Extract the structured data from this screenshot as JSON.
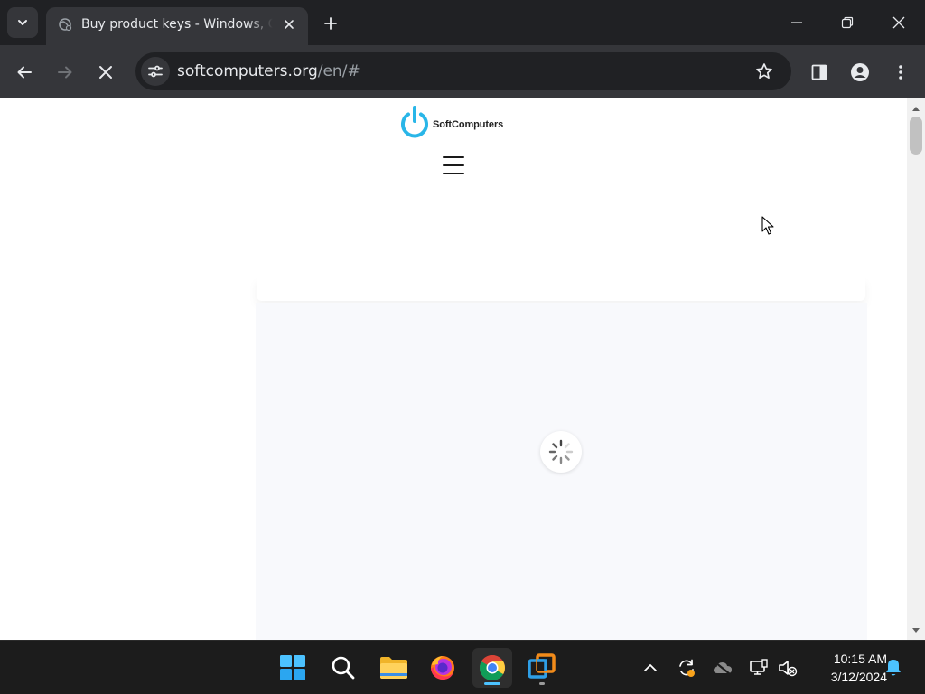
{
  "browser": {
    "tab": {
      "title": "Buy product keys - Windows, Office",
      "favicon": "globe-loading-icon"
    },
    "url": {
      "host": "softcomputers.org",
      "path": "/en/#"
    },
    "icons": {
      "tab_search": "chevron-down-icon",
      "tab_close": "close-icon",
      "new_tab": "plus-icon",
      "minimize": "minimize-icon",
      "restore": "restore-icon",
      "close_window": "close-icon",
      "back": "arrow-left-icon",
      "forward": "arrow-right-icon",
      "stop": "stop-icon",
      "site_info": "tune-icon",
      "bookmark": "star-icon",
      "side_panel": "side-panel-icon",
      "profile": "profile-icon",
      "menu": "more-vertical-icon"
    },
    "colors": {
      "frame": "#202124",
      "toolbar": "#35363a",
      "text": "#e8eaed"
    }
  },
  "page": {
    "logo_text": "SoftComputers",
    "logo_color": "#29b6e8",
    "menu_icon": "hamburger-menu-icon",
    "loading_icon": "spinner-icon",
    "loading_bg": "#f8f9fc"
  },
  "taskbar": {
    "apps": [
      {
        "name": "Start",
        "icon": "windows-start-icon"
      },
      {
        "name": "Search",
        "icon": "search-icon"
      },
      {
        "name": "File Explorer",
        "icon": "folder-icon"
      },
      {
        "name": "Firefox",
        "icon": "firefox-icon"
      },
      {
        "name": "Google Chrome",
        "icon": "chrome-icon",
        "active": true
      },
      {
        "name": "VMware",
        "icon": "vmware-icon"
      }
    ],
    "tray": [
      "chevron-up-icon",
      "sync-icon",
      "onedrive-icon",
      "network-icon",
      "volume-muted-icon"
    ],
    "time": "10:15 AM",
    "date": "3/12/2024",
    "notification_icon": "bell-icon"
  }
}
